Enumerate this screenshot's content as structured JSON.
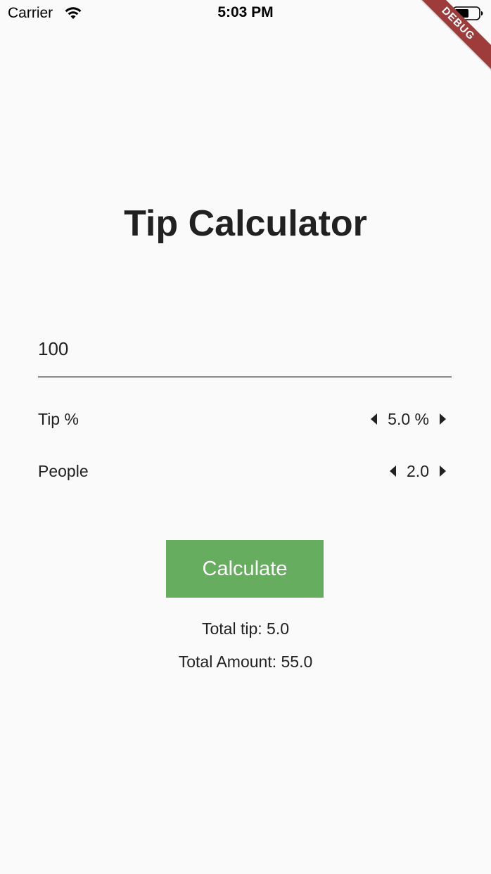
{
  "status_bar": {
    "carrier": "Carrier",
    "time": "5:03 PM"
  },
  "debug_banner": "DEBUG",
  "title": "Tip Calculator",
  "bill_input": {
    "value": "100"
  },
  "tip_row": {
    "label": "Tip %",
    "value": "5.0 %"
  },
  "people_row": {
    "label": "People",
    "value": "2.0"
  },
  "calculate_button": {
    "label": "Calculate"
  },
  "results": {
    "total_tip": "Total tip: 5.0",
    "total_amount": "Total Amount: 55.0"
  },
  "colors": {
    "background": "#fafafa",
    "button": "#66ad5f",
    "button_text": "#ffffff",
    "text": "#212121",
    "debug_ribbon": "#9e3b3b"
  },
  "icons": {
    "wifi": "wifi-icon",
    "battery": "battery-icon",
    "decrement": "caret-left-icon",
    "increment": "caret-right-icon"
  }
}
